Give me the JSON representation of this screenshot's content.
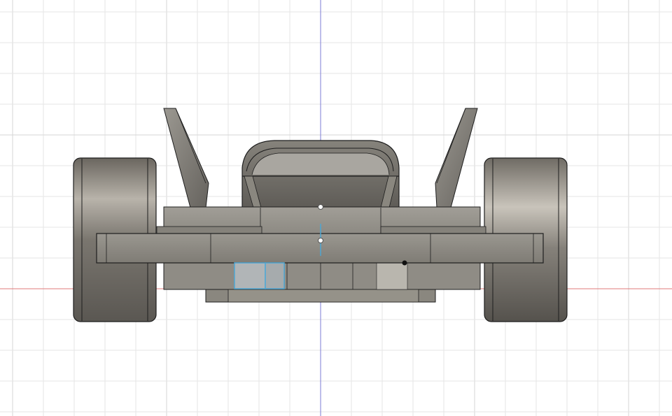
{
  "viewport": {
    "background": "#ffffff",
    "grid_color": "#e6e6e6",
    "grid_major_color": "#d6d6d6",
    "axis_vertical_color": "#7b7bd6",
    "axis_horizontal_color": "#e07878",
    "selection_color": "#4aa8d8"
  },
  "model": {
    "view": "front",
    "body_color": "#8e8b84",
    "body_dark": "#5d5a55",
    "body_light": "#b3b0a9",
    "edge_color": "#1e1e1e",
    "wheel_count": 2,
    "selected_face_count": 2
  }
}
